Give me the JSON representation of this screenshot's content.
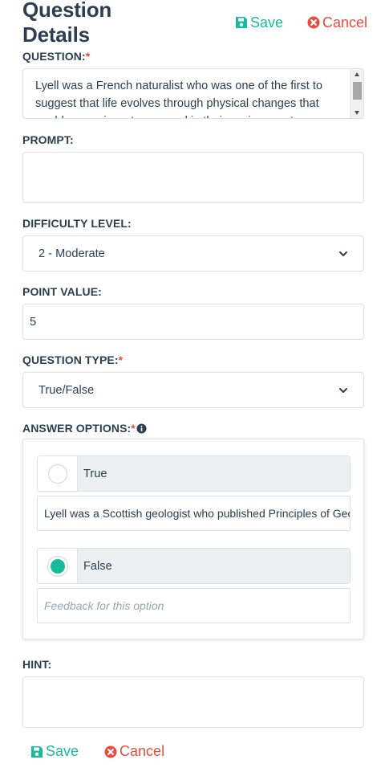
{
  "header": {
    "title": "Question Details",
    "save_label": "Save",
    "cancel_label": "Cancel"
  },
  "question": {
    "label": "QUESTION:",
    "required_mark": "*",
    "value": "Lyell was a French naturalist who was one of the first to suggest that life evolves through physical changes that enable organisms to succeed in their environment."
  },
  "prompt": {
    "label": "PROMPT:",
    "value": ""
  },
  "difficulty": {
    "label": "DIFFICULTY LEVEL:",
    "selected": "2 - Moderate"
  },
  "point_value": {
    "label": "POINT VALUE:",
    "value": "5"
  },
  "question_type": {
    "label": "QUESTION TYPE:",
    "required_mark": "*",
    "selected": "True/False"
  },
  "answer_options": {
    "label": "ANSWER OPTIONS:",
    "required_mark": "*",
    "info_icon": "info-circle-icon",
    "options": [
      {
        "label": "True",
        "selected": false,
        "feedback": "Lyell was a Scottish geologist who published Principles of Geology"
      },
      {
        "label": "False",
        "selected": true,
        "feedback": "",
        "feedback_placeholder": "Feedback for this option"
      }
    ]
  },
  "hint": {
    "label": "HINT:",
    "value": ""
  },
  "footer": {
    "save_label": "Save",
    "cancel_label": "Cancel"
  },
  "colors": {
    "primary_text": "#2c3e50",
    "success": "#18bc9c",
    "danger": "#e74c3c",
    "option_bg": "#ecf0f1"
  }
}
